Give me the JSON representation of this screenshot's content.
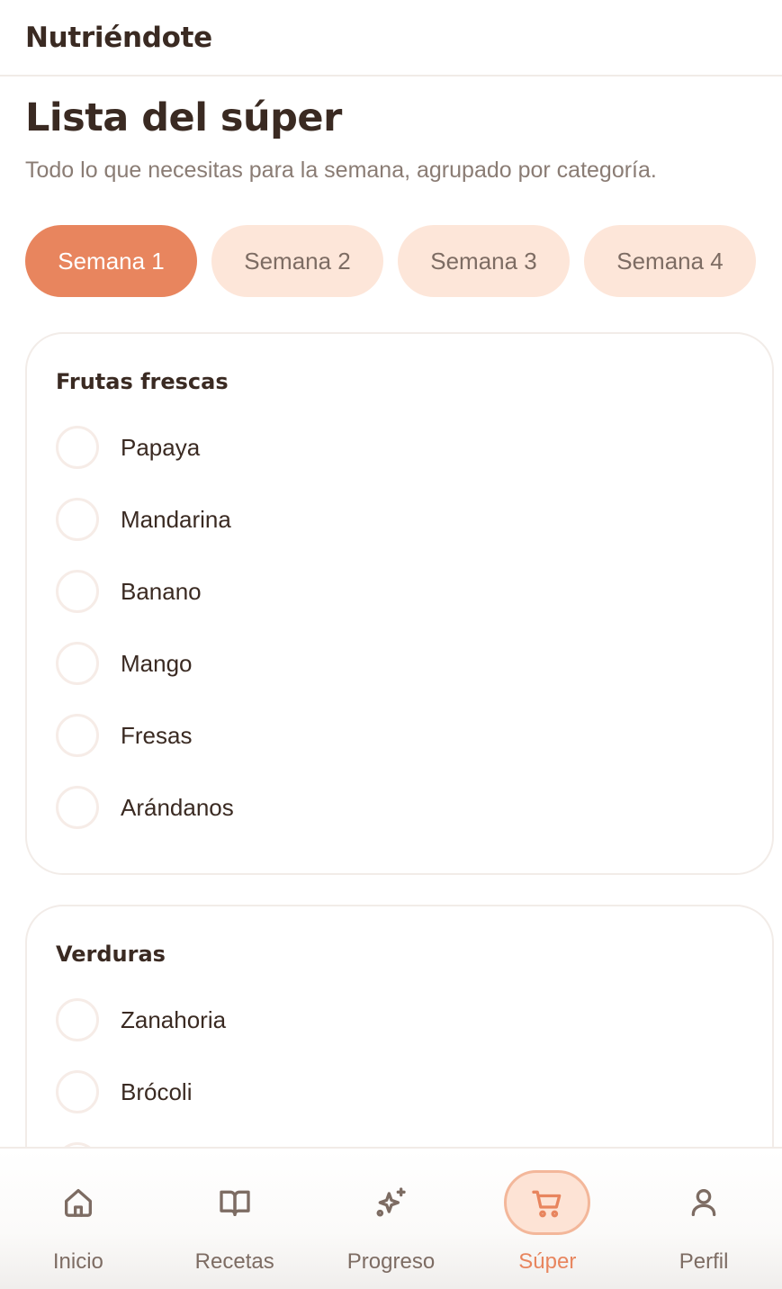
{
  "app": {
    "brand": "Nutriéndote"
  },
  "header": {
    "title": "Lista del súper",
    "subtitle": "Todo lo que necesitas para la semana, agrupado por categoría."
  },
  "weeks": [
    {
      "label": "Semana 1",
      "active": true
    },
    {
      "label": "Semana 2",
      "active": false
    },
    {
      "label": "Semana 3",
      "active": false
    },
    {
      "label": "Semana 4",
      "active": false
    }
  ],
  "categories": [
    {
      "title": "Frutas frescas",
      "items": [
        "Papaya",
        "Mandarina",
        "Banano",
        "Mango",
        "Fresas",
        "Arándanos"
      ]
    },
    {
      "title": "Verduras",
      "items": [
        "Zanahoria",
        "Brócoli"
      ]
    }
  ],
  "nav": [
    {
      "label": "Inicio",
      "icon": "home-icon",
      "active": false
    },
    {
      "label": "Recetas",
      "icon": "book-icon",
      "active": false
    },
    {
      "label": "Progreso",
      "icon": "sparkles-icon",
      "active": false
    },
    {
      "label": "Súper",
      "icon": "cart-icon",
      "active": true
    },
    {
      "label": "Perfil",
      "icon": "user-icon",
      "active": false
    }
  ],
  "colors": {
    "accent": "#e8855e",
    "accent_soft": "#fde6d9",
    "text": "#3a2a22",
    "muted": "#8a7c74"
  }
}
